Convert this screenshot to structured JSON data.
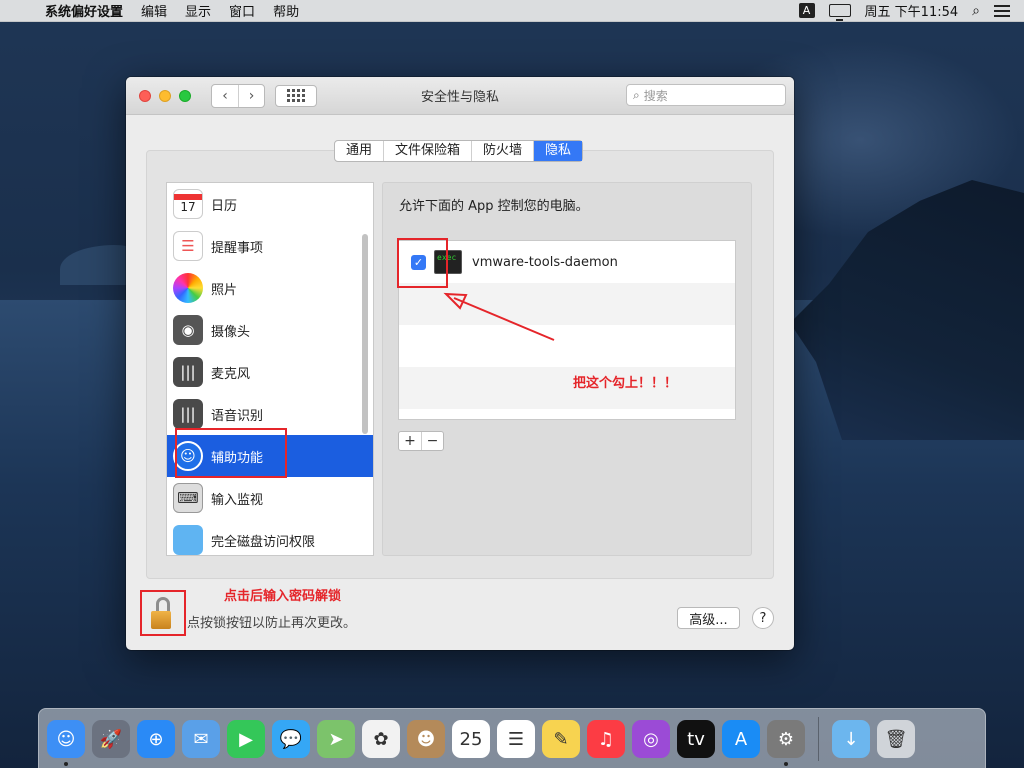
{
  "menubar": {
    "apple_icon": "apple-logo",
    "app_name": "系统偏好设置",
    "menus": [
      "编辑",
      "显示",
      "窗口",
      "帮助"
    ],
    "input_source": "A",
    "clock": "周五 下午11:54"
  },
  "window": {
    "title": "安全性与隐私",
    "search_placeholder": "搜索",
    "tabs": [
      {
        "label": "通用",
        "active": false
      },
      {
        "label": "文件保险箱",
        "active": false
      },
      {
        "label": "防火墙",
        "active": false
      },
      {
        "label": "隐私",
        "active": true
      }
    ],
    "sidebar": [
      {
        "label": "日历",
        "icon": "calendar-icon",
        "glyph": "17"
      },
      {
        "label": "提醒事项",
        "icon": "reminders-icon",
        "glyph": "☰"
      },
      {
        "label": "照片",
        "icon": "photos-icon",
        "glyph": ""
      },
      {
        "label": "摄像头",
        "icon": "camera-icon",
        "glyph": "◉"
      },
      {
        "label": "麦克风",
        "icon": "microphone-icon",
        "glyph": "|||"
      },
      {
        "label": "语音识别",
        "icon": "speech-recognition-icon",
        "glyph": "|||"
      },
      {
        "label": "辅助功能",
        "icon": "accessibility-icon",
        "glyph": "☺",
        "selected": true
      },
      {
        "label": "输入监视",
        "icon": "keyboard-icon",
        "glyph": "⌨"
      },
      {
        "label": "完全磁盘访问权限",
        "icon": "folder-icon",
        "glyph": ""
      }
    ],
    "allow_label": "允许下面的 App 控制您的电脑。",
    "apps": [
      {
        "name": "vmware-tools-daemon",
        "checked": true
      }
    ],
    "plus": "+",
    "minus": "−",
    "lock_text": "点按锁按钮以防止再次更改。",
    "advanced_button": "高级...",
    "help_button": "?"
  },
  "annotations": {
    "check_hint": "把这个勾上！！！",
    "unlock_hint": "点击后输入密码解锁",
    "color": "#e5252a"
  },
  "dock": [
    {
      "name": "finder-icon",
      "color": "#3d8ff5",
      "glyph": "☺",
      "running": true
    },
    {
      "name": "launchpad-icon",
      "color": "#6b7280",
      "glyph": "🚀",
      "running": false
    },
    {
      "name": "safari-icon",
      "color": "#2a8af6",
      "glyph": "⊕",
      "running": false
    },
    {
      "name": "mail-icon",
      "color": "#5aa0e8",
      "glyph": "✉",
      "running": false
    },
    {
      "name": "facetime-icon",
      "color": "#34c759",
      "glyph": "▶",
      "running": false
    },
    {
      "name": "messages-icon",
      "color": "#35a7f5",
      "glyph": "💬",
      "running": false
    },
    {
      "name": "maps-icon",
      "color": "#7cc36b",
      "glyph": "➤",
      "running": false
    },
    {
      "name": "photos-icon",
      "color": "#f2f2f2",
      "glyph": "✿",
      "running": false
    },
    {
      "name": "contacts-icon",
      "color": "#b48a5a",
      "glyph": "☻",
      "running": false
    },
    {
      "name": "calendar-icon",
      "color": "#ffffff",
      "glyph": "25",
      "running": false
    },
    {
      "name": "reminders-icon",
      "color": "#ffffff",
      "glyph": "☰",
      "running": false
    },
    {
      "name": "notes-icon",
      "color": "#f7d350",
      "glyph": "✎",
      "running": false
    },
    {
      "name": "music-icon",
      "color": "#fc3c44",
      "glyph": "♫",
      "running": false
    },
    {
      "name": "podcasts-icon",
      "color": "#9b4bd6",
      "glyph": "◎",
      "running": false
    },
    {
      "name": "apple-tv-icon",
      "color": "#111111",
      "glyph": "tv",
      "running": false
    },
    {
      "name": "app-store-icon",
      "color": "#1a8cf5",
      "glyph": "A",
      "running": false
    },
    {
      "name": "system-preferences-icon",
      "color": "#7a7a7a",
      "glyph": "⚙",
      "running": true
    },
    {
      "name": "downloads-folder-icon",
      "color": "#6cb6ee",
      "glyph": "↓",
      "running": false
    },
    {
      "name": "trash-icon",
      "color": "#d0d4d9",
      "glyph": "🗑",
      "running": false
    }
  ]
}
